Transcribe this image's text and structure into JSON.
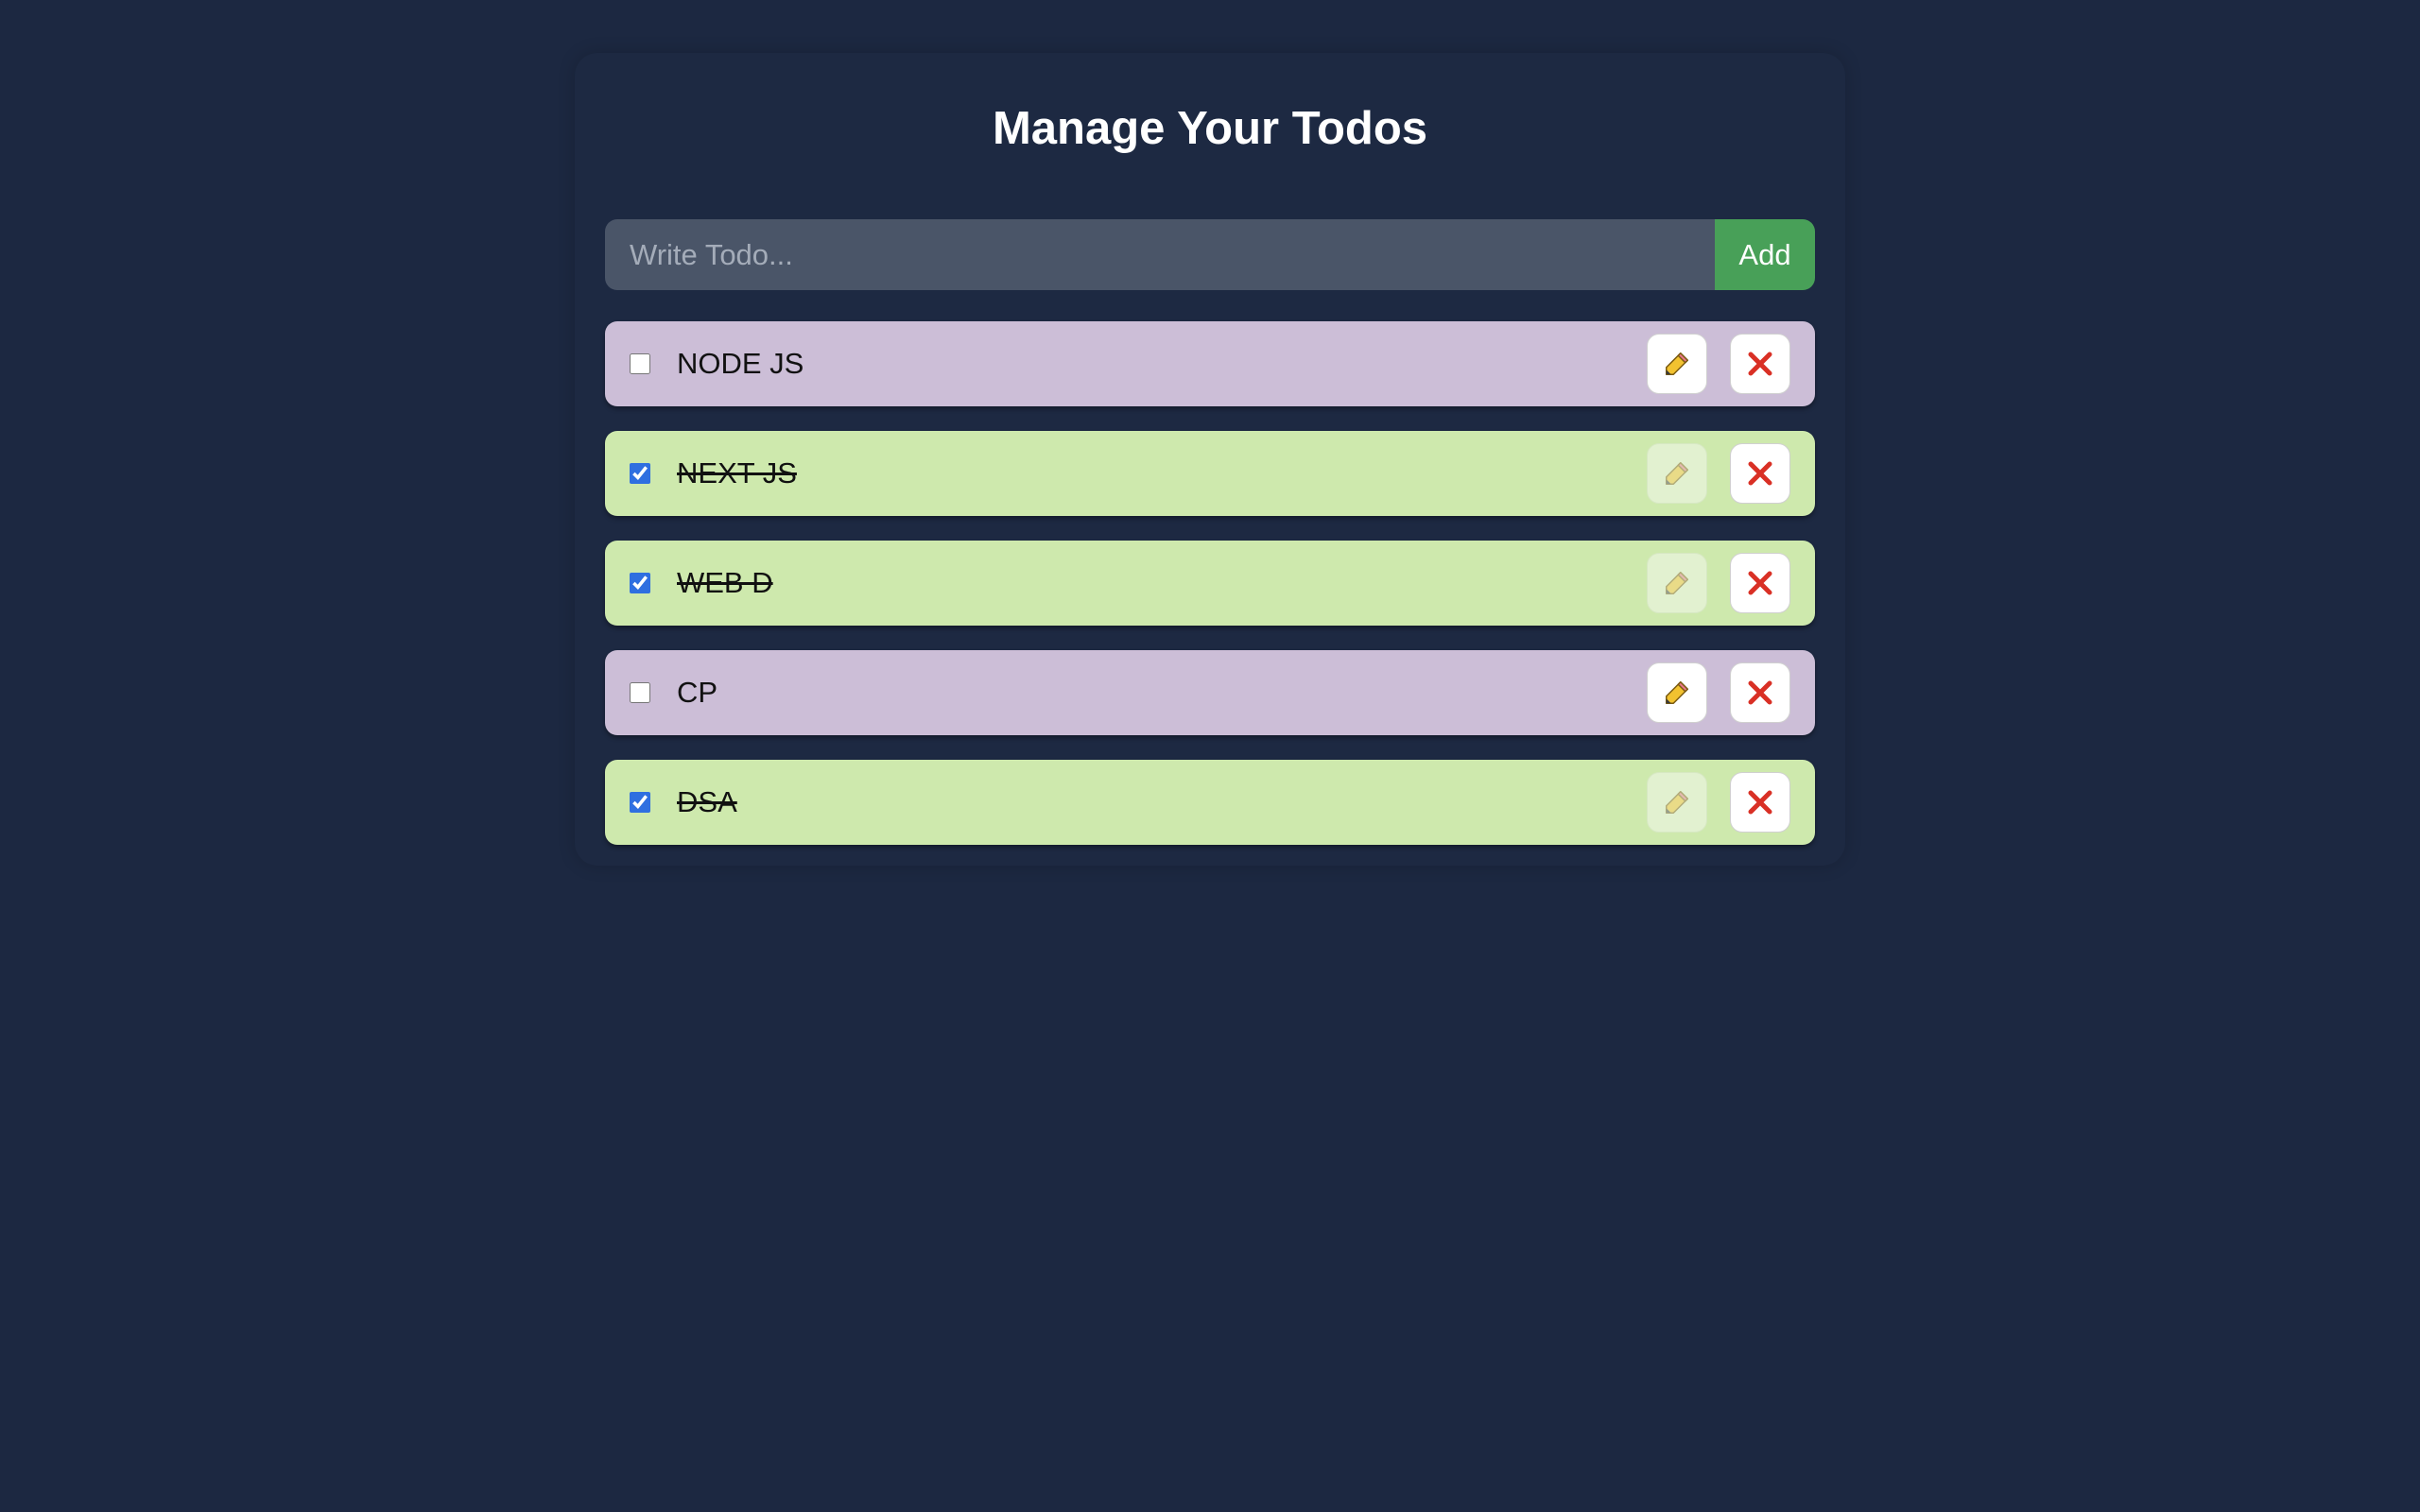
{
  "header": {
    "title": "Manage Your Todos"
  },
  "composer": {
    "placeholder": "Write Todo...",
    "value": "",
    "add_label": "Add"
  },
  "todos": [
    {
      "text": "NODE JS",
      "completed": false
    },
    {
      "text": "NEXT JS",
      "completed": true
    },
    {
      "text": "WEB D",
      "completed": true
    },
    {
      "text": "CP",
      "completed": false
    },
    {
      "text": "DSA",
      "completed": true
    }
  ],
  "icons": {
    "edit": "pencil-icon",
    "delete": "close-icon"
  },
  "colors": {
    "background": "#1c2841",
    "add_button": "#48a058",
    "pending_row": "#ccbed7",
    "completed_row": "#cee9ad",
    "delete_icon": "#d93025"
  }
}
